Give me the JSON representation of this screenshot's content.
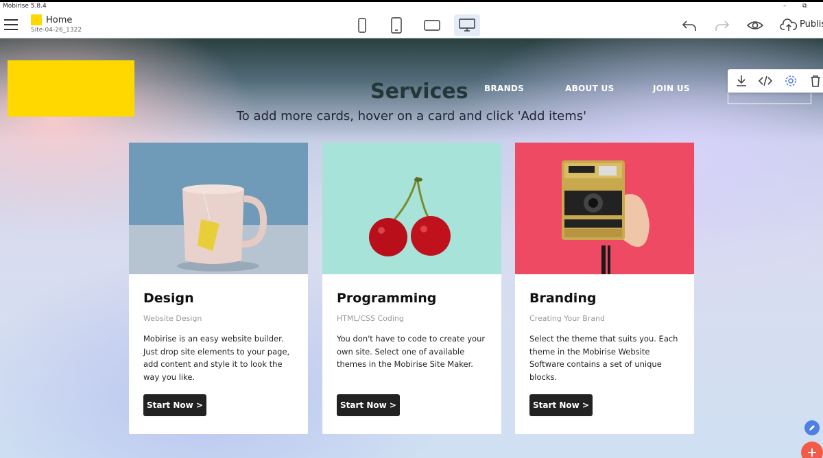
{
  "window": {
    "title": "Mobirise 5.8.4"
  },
  "toolbar": {
    "site_name": "Home",
    "site_id": "Site-04-26_1322",
    "publish_label": "Publis"
  },
  "page": {
    "services_title": "Services",
    "subtitle": "To add more cards, hover on a card and click 'Add items'",
    "nav": [
      "BRANDS",
      "ABOUT US",
      "JOIN US"
    ]
  },
  "cards": [
    {
      "title": "Design",
      "subtitle": "Website Design",
      "description": "Mobirise is an easy website builder. Just drop site elements to your page, add content and style it to look the way you like.",
      "button": "Start Now >"
    },
    {
      "title": "Programming",
      "subtitle": "HTML/CSS Coding",
      "description": "You don't have to code to create your own site. Select one of available themes in the Mobirise Site Maker.",
      "button": "Start Now >"
    },
    {
      "title": "Branding",
      "subtitle": "Creating Your Brand",
      "description": "Select the theme that suits you. Each theme in the Mobirise Website Software contains a set of unique blocks.",
      "button": "Start Now >"
    }
  ],
  "colors": {
    "brand_yellow": "#ffd800",
    "button_dark": "#222222",
    "accent_blue": "#4f7fe0",
    "add_red": "#f25a4a"
  },
  "icons": {
    "menu": "hamburger-icon",
    "devices": [
      "phone-icon",
      "phone-large-icon",
      "tablet-icon",
      "desktop-icon"
    ],
    "actions": [
      "undo-icon",
      "redo-icon",
      "preview-eye-icon",
      "cloud-upload-icon"
    ],
    "block_tools": [
      "download-icon",
      "code-icon",
      "gear-icon",
      "trash-icon"
    ]
  }
}
